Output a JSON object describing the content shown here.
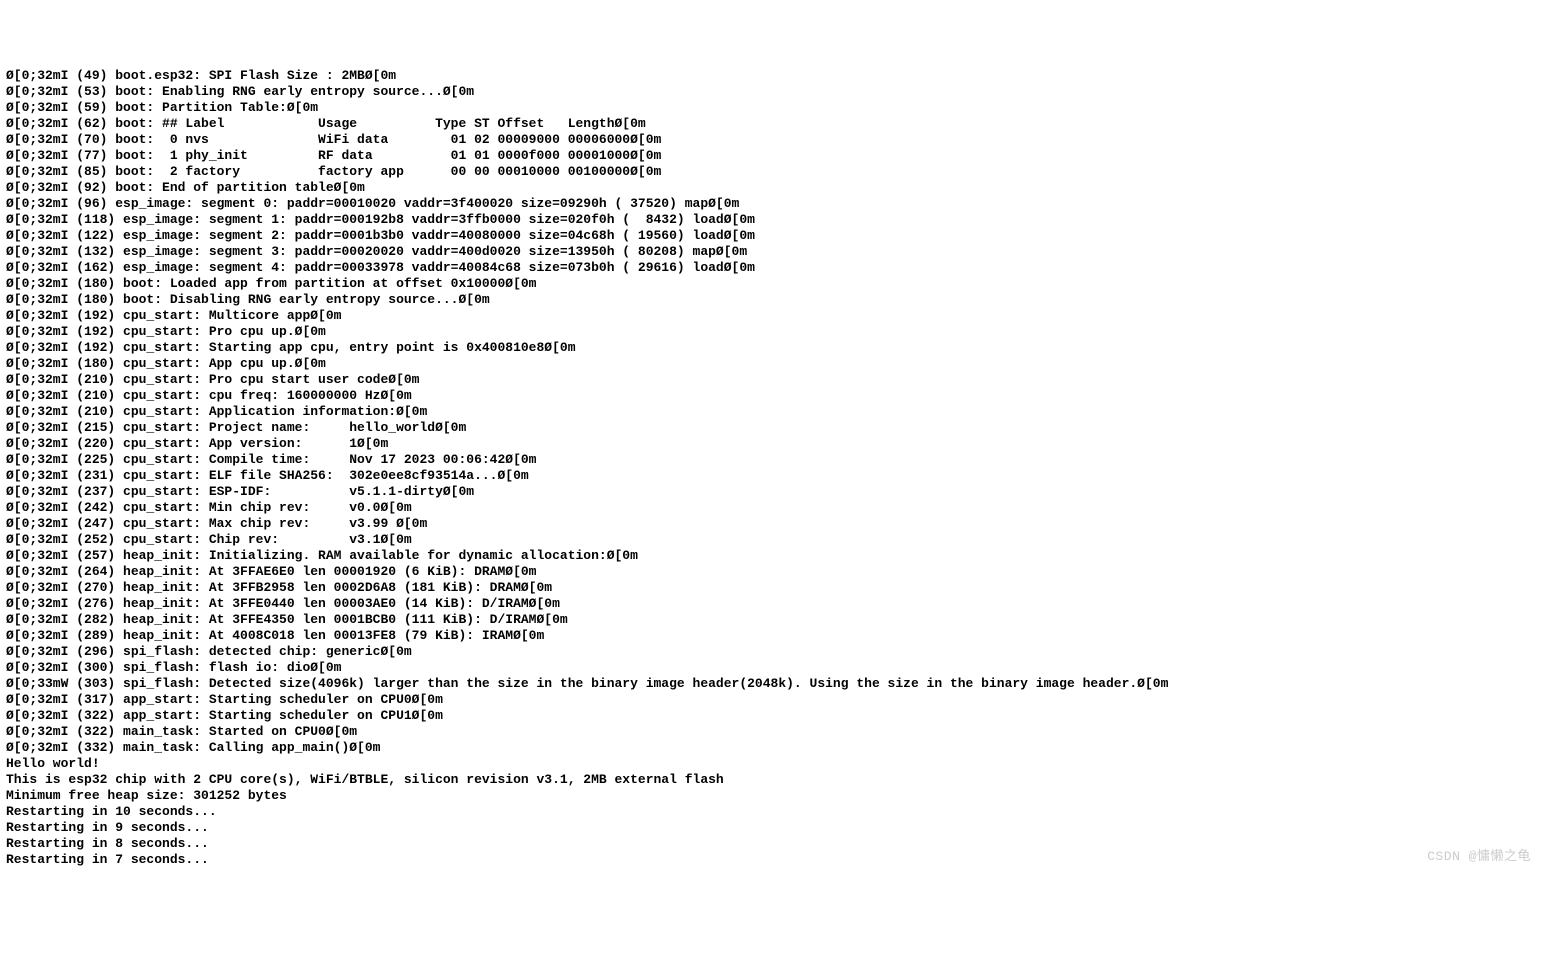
{
  "watermark": "CSDN @慵懒之龟",
  "ansi_prefix_green": "Ø[0;32m",
  "ansi_prefix_yellow": "Ø[0;33m",
  "ansi_suffix": "Ø[0m",
  "lines": [
    {
      "p": "g",
      "t": "I (49) boot.esp32: SPI Flash Size : 2MB"
    },
    {
      "p": "g",
      "t": "I (53) boot: Enabling RNG early entropy source..."
    },
    {
      "p": "g",
      "t": "I (59) boot: Partition Table:"
    },
    {
      "p": "g",
      "t": "I (62) boot: ## Label            Usage          Type ST Offset   Length"
    },
    {
      "p": "g",
      "t": "I (70) boot:  0 nvs              WiFi data        01 02 00009000 00006000"
    },
    {
      "p": "g",
      "t": "I (77) boot:  1 phy_init         RF data          01 01 0000f000 00001000"
    },
    {
      "p": "g",
      "t": "I (85) boot:  2 factory          factory app      00 00 00010000 00100000"
    },
    {
      "p": "g",
      "t": "I (92) boot: End of partition table"
    },
    {
      "p": "g",
      "t": "I (96) esp_image: segment 0: paddr=00010020 vaddr=3f400020 size=09290h ( 37520) map"
    },
    {
      "p": "g",
      "t": "I (118) esp_image: segment 1: paddr=000192b8 vaddr=3ffb0000 size=020f0h (  8432) load"
    },
    {
      "p": "g",
      "t": "I (122) esp_image: segment 2: paddr=0001b3b0 vaddr=40080000 size=04c68h ( 19560) load"
    },
    {
      "p": "g",
      "t": "I (132) esp_image: segment 3: paddr=00020020 vaddr=400d0020 size=13950h ( 80208) map"
    },
    {
      "p": "g",
      "t": "I (162) esp_image: segment 4: paddr=00033978 vaddr=40084c68 size=073b0h ( 29616) load"
    },
    {
      "p": "g",
      "t": "I (180) boot: Loaded app from partition at offset 0x10000"
    },
    {
      "p": "g",
      "t": "I (180) boot: Disabling RNG early entropy source..."
    },
    {
      "p": "g",
      "t": "I (192) cpu_start: Multicore app"
    },
    {
      "p": "g",
      "t": "I (192) cpu_start: Pro cpu up."
    },
    {
      "p": "g",
      "t": "I (192) cpu_start: Starting app cpu, entry point is 0x400810e8"
    },
    {
      "p": "g",
      "t": "I (180) cpu_start: App cpu up."
    },
    {
      "p": "g",
      "t": "I (210) cpu_start: Pro cpu start user code"
    },
    {
      "p": "g",
      "t": "I (210) cpu_start: cpu freq: 160000000 Hz"
    },
    {
      "p": "g",
      "t": "I (210) cpu_start: Application information:"
    },
    {
      "p": "g",
      "t": "I (215) cpu_start: Project name:     hello_world"
    },
    {
      "p": "g",
      "t": "I (220) cpu_start: App version:      1"
    },
    {
      "p": "g",
      "t": "I (225) cpu_start: Compile time:     Nov 17 2023 00:06:42"
    },
    {
      "p": "g",
      "t": "I (231) cpu_start: ELF file SHA256:  302e0ee8cf93514a..."
    },
    {
      "p": "g",
      "t": "I (237) cpu_start: ESP-IDF:          v5.1.1-dirty"
    },
    {
      "p": "g",
      "t": "I (242) cpu_start: Min chip rev:     v0.0"
    },
    {
      "p": "g",
      "t": "I (247) cpu_start: Max chip rev:     v3.99 "
    },
    {
      "p": "g",
      "t": "I (252) cpu_start: Chip rev:         v3.1"
    },
    {
      "p": "g",
      "t": "I (257) heap_init: Initializing. RAM available for dynamic allocation:"
    },
    {
      "p": "g",
      "t": "I (264) heap_init: At 3FFAE6E0 len 00001920 (6 KiB): DRAM"
    },
    {
      "p": "g",
      "t": "I (270) heap_init: At 3FFB2958 len 0002D6A8 (181 KiB): DRAM"
    },
    {
      "p": "g",
      "t": "I (276) heap_init: At 3FFE0440 len 00003AE0 (14 KiB): D/IRAM"
    },
    {
      "p": "g",
      "t": "I (282) heap_init: At 3FFE4350 len 0001BCB0 (111 KiB): D/IRAM"
    },
    {
      "p": "g",
      "t": "I (289) heap_init: At 4008C018 len 00013FE8 (79 KiB): IRAM"
    },
    {
      "p": "g",
      "t": "I (296) spi_flash: detected chip: generic"
    },
    {
      "p": "g",
      "t": "I (300) spi_flash: flash io: dio"
    },
    {
      "p": "y",
      "t": "W (303) spi_flash: Detected size(4096k) larger than the size in the binary image header(2048k). Using the size in the binary image header."
    },
    {
      "p": "g",
      "t": "I (317) app_start: Starting scheduler on CPU0"
    },
    {
      "p": "g",
      "t": "I (322) app_start: Starting scheduler on CPU1"
    },
    {
      "p": "g",
      "t": "I (322) main_task: Started on CPU0"
    },
    {
      "p": "g",
      "t": "I (332) main_task: Calling app_main()"
    },
    {
      "p": "",
      "t": "Hello world!"
    },
    {
      "p": "",
      "t": "This is esp32 chip with 2 CPU core(s), WiFi/BTBLE, silicon revision v3.1, 2MB external flash"
    },
    {
      "p": "",
      "t": "Minimum free heap size: 301252 bytes"
    },
    {
      "p": "",
      "t": "Restarting in 10 seconds..."
    },
    {
      "p": "",
      "t": "Restarting in 9 seconds..."
    },
    {
      "p": "",
      "t": "Restarting in 8 seconds..."
    },
    {
      "p": "",
      "t": "Restarting in 7 seconds..."
    }
  ]
}
